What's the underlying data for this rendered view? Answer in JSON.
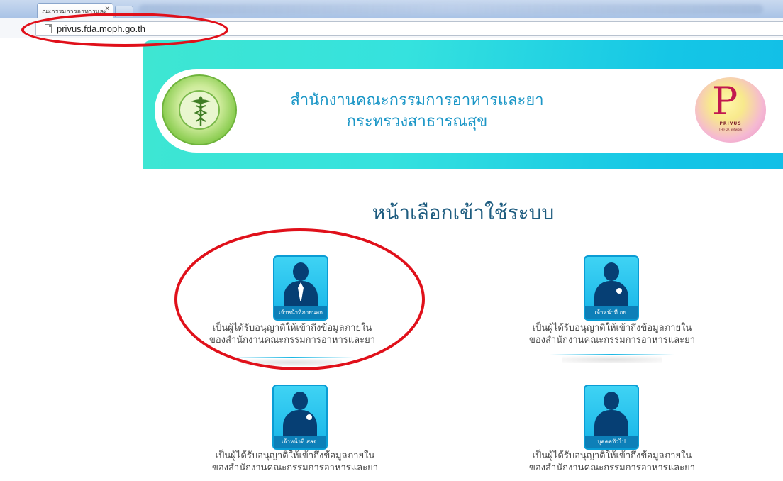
{
  "browser": {
    "tab_title": "ณะกรรมการอาหารและ",
    "tab_close": "✕",
    "url": "privus.fda.moph.go.th"
  },
  "banner": {
    "title_line1": "สำนักงานคณะกรรมการอาหารและยา",
    "title_line2": "กระทรวงสาธารณสุข",
    "privus_logo_letter": "P",
    "privus_logo_word": "PRIVUS",
    "privus_logo_sub": "TH FDA Network"
  },
  "page": {
    "heading": "หน้าเลือกเข้าใช้ระบบ"
  },
  "cards": [
    {
      "label": "เจ้าหน้าที่ภายนอก",
      "desc_line1": "เป็นผู้ได้รับอนุญาติให้เข้าถึงข้อมูลภายใน",
      "desc_line2": "ของสำนักงานคณะกรรมการอาหารและยา"
    },
    {
      "label": "เจ้าหน้าที่ อย.",
      "desc_line1": "เป็นผู้ได้รับอนุญาติให้เข้าถึงข้อมูลภายใน",
      "desc_line2": "ของสำนักงานคณะกรรมการอาหารและยา"
    },
    {
      "label": "เจ้าหน้าที่ สสจ.",
      "desc_line1": "เป็นผู้ได้รับอนุญาติให้เข้าถึงข้อมูลภายใน",
      "desc_line2": "ของสำนักงานคณะกรรมการอาหารและยา"
    },
    {
      "label": "บุคคลทั่วไป",
      "desc_line1": "เป็นผู้ได้รับอนุญาติให้เข้าถึงข้อมูลภายใน",
      "desc_line2": "ของสำนักงานคณะกรรมการอาหารและยา"
    }
  ],
  "colors": {
    "banner_start": "#3ee6d2",
    "banner_end": "#12bfe7",
    "title_color": "#1c97c7",
    "heading_color": "#1f5d80",
    "icon_blue": "#16b4e8",
    "person_navy": "#063f74",
    "annotation_red": "#e0101a"
  }
}
